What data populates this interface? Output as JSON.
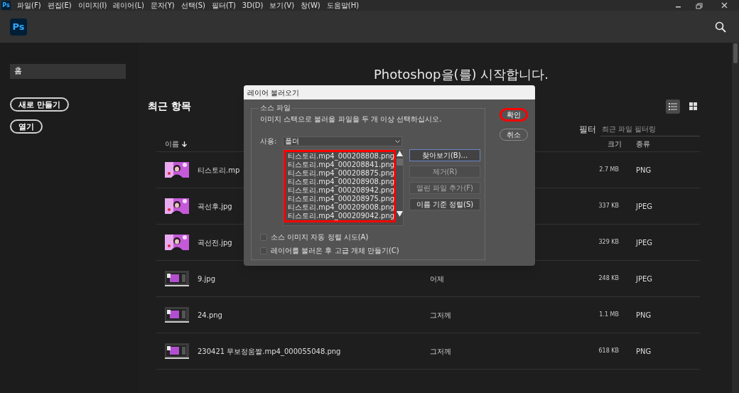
{
  "menu_bar": {
    "logo": "Ps",
    "items": [
      "파일(F)",
      "편집(E)",
      "이미지(I)",
      "레이어(L)",
      "문자(Y)",
      "선택(S)",
      "필터(T)",
      "3D(D)",
      "보기(V)",
      "창(W)",
      "도움말(H)"
    ]
  },
  "header": {
    "logo": "Ps"
  },
  "sidebar": {
    "items": [
      {
        "label": "홈",
        "selected": true
      }
    ],
    "buttons": [
      "새로 만들기",
      "열기"
    ]
  },
  "welcome": "Photoshop을(를) 시작합니다.",
  "recent": {
    "title": "최근 항목",
    "views": [
      {
        "kind": "list",
        "selected": true
      },
      {
        "kind": "grid",
        "selected": false
      }
    ],
    "filter": {
      "label": "필터",
      "placeholder": "최근 파일 필터링"
    },
    "columns": [
      {
        "label": "이름",
        "sorted": true
      },
      {
        "label": "크기",
        "sorted": false
      },
      {
        "label": "종류",
        "sorted": false
      }
    ],
    "rows": [
      {
        "name": "티스토리.mp",
        "modified": "",
        "size": "2.7 MB",
        "type": "PNG"
      },
      {
        "name": "곡선후.jpg",
        "modified": "",
        "size": "337 KB",
        "type": "JPEG"
      },
      {
        "name": "곡선전.jpg",
        "modified": "",
        "size": "329 KB",
        "type": "JPEG"
      },
      {
        "name": "9.jpg",
        "modified": "어제",
        "size": "248 KB",
        "type": "JPEG"
      },
      {
        "name": "24.png",
        "modified": "그저께",
        "size": "1.1 MB",
        "type": "PNG"
      },
      {
        "name": "230421 무보정움짤.mp4_000055048.png",
        "modified": "그저께",
        "size": "618 KB",
        "type": "PNG"
      }
    ]
  },
  "dialog": {
    "title": "레이어 불러오기",
    "group_label": "소스 파일",
    "instruction": "이미지 스택으로 불러올 파일을 두 개 이상 선택하십시오.",
    "use_label": "사용:",
    "use_value": "폴더",
    "files": [
      "티스토리.mp4_000208808.png",
      "티스토리.mp4_000208841.png",
      "티스토리.mp4_000208875.png",
      "티스토리.mp4_000208908.png",
      "티스토리.mp4_000208942.png",
      "티스토리.mp4_000208975.png",
      "티스토리.mp4_000209008.png",
      "티스토리.mp4_000209042.png"
    ],
    "buttons": [
      {
        "label": "찾아보기(B)...",
        "disabled": false,
        "focused": true
      },
      {
        "label": "제거(R)",
        "disabled": true,
        "focused": false
      },
      {
        "label": "열린 파일 추가(F)",
        "disabled": true,
        "focused": false
      },
      {
        "label": "이름 기준 정렬(S)",
        "disabled": false,
        "focused": false
      }
    ],
    "checkboxes": [
      {
        "label": "소스 이미지 자동 정렬 시도(A)",
        "checked": false
      },
      {
        "label": "레이어를 불러온 후 고급 개체 만들기(C)",
        "checked": false
      }
    ],
    "ok": "확인",
    "cancel": "취소"
  }
}
